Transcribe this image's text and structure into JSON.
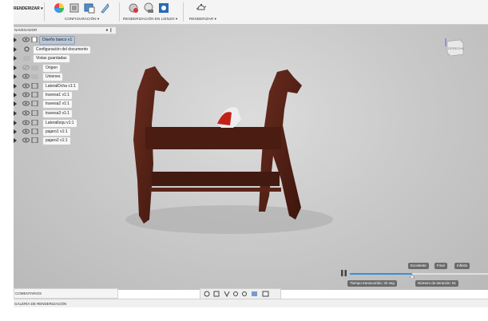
{
  "ribbon": {
    "workspace_label": "RENDERIZAR ▾",
    "groups": {
      "setup": "CONFIGURACIÓN ▾",
      "incanvas": "RENDERIZACIÓN EN LIENZO ▾",
      "render": "RENDERIZAR ▾"
    }
  },
  "browser": {
    "title": "NAVEGADOR",
    "controls": "● ❙",
    "items": [
      {
        "label": "Diseño banco v1"
      },
      {
        "label": "Configuración del documento"
      },
      {
        "label": "Vistas guardadas"
      },
      {
        "label": "Origen"
      },
      {
        "label": "Uniones"
      },
      {
        "label": "LateralDcha v1:1"
      },
      {
        "label": "travesa1 v1:1"
      },
      {
        "label": "travesa2 v1:1"
      },
      {
        "label": "travesa3 v1:1"
      },
      {
        "label": "LateralIzqu v1:1"
      },
      {
        "label": "pajaro1 v1:1"
      },
      {
        "label": "pajaro2 v1:1"
      }
    ]
  },
  "viewcube": {
    "face": "DERECHA"
  },
  "render_progress": {
    "quality_levels": [
      "Excelente",
      "Final",
      "Infinito"
    ],
    "time_elapsed": "Tiempo transcurrido: 32 seg",
    "iteration": "Número de iteración: 51",
    "progress": 0.45
  },
  "bottom": {
    "comments": "COMENTARIOS",
    "gallery": "GALERÍA DE RENDERIZACIÓN"
  },
  "colors": {
    "wood": "#5a2418",
    "viewport": "#c9c9c9",
    "progress": "#3d8fd0"
  }
}
